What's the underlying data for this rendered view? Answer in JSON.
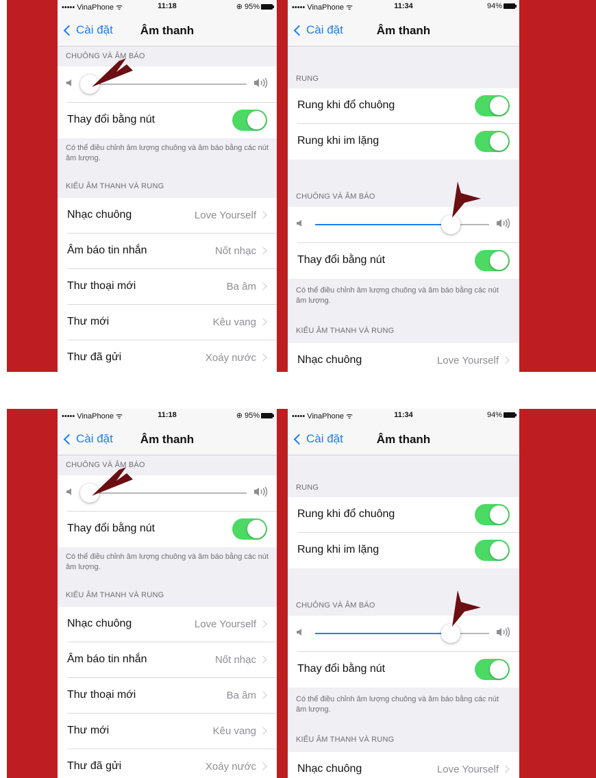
{
  "colors": {
    "frame_red": "#be1e22",
    "accent_blue": "#1a7ef2",
    "toggle_green": "#4cd964",
    "pointer": "#6b0f12"
  },
  "screens": [
    {
      "status": {
        "carrier": "••••• VinaPhone ᯤ",
        "time": "11:18",
        "battery": "⊕ 95%"
      },
      "nav": {
        "back": "Cài đặt",
        "title": "Âm thanh"
      },
      "ringer_header": "CHUÔNG VÀ ÂM BÁO",
      "ringer_level": 0.03,
      "change_with_buttons": "Thay đổi bằng nút",
      "note": "Có thể điều chỉnh âm lượng chuông và âm báo bằng các nút âm lượng.",
      "patterns_header": "KIỂU ÂM THANH VÀ RUNG",
      "items": [
        {
          "label": "Nhạc chuông",
          "value": "Love Yourself"
        },
        {
          "label": "Âm báo tin nhắn",
          "value": "Nốt nhạc"
        },
        {
          "label": "Thư thoại mới",
          "value": "Ba âm"
        },
        {
          "label": "Thư mới",
          "value": "Kêu vang"
        },
        {
          "label": "Thư đã gửi",
          "value": "Xoáy nước"
        }
      ]
    },
    {
      "status": {
        "carrier": "••••• VinaPhone ᯤ",
        "time": "11:34",
        "battery": "94%"
      },
      "nav": {
        "back": "Cài đặt",
        "title": "Âm thanh"
      },
      "vibrate_header": "RUNG",
      "vibrate_ring": "Rung khi đổ chuông",
      "vibrate_silent": "Rung khi im lặng",
      "ringer_header": "CHUÔNG VÀ ÂM BÁO",
      "ringer_level": 0.78,
      "change_with_buttons": "Thay đổi bằng nút",
      "note": "Có thể điều chỉnh âm lượng chuông và âm báo bằng các nút âm lượng.",
      "patterns_header": "KIỂU ÂM THANH VÀ RUNG",
      "items": [
        {
          "label": "Nhạc chuông",
          "value": "Love Yourself"
        }
      ]
    }
  ]
}
